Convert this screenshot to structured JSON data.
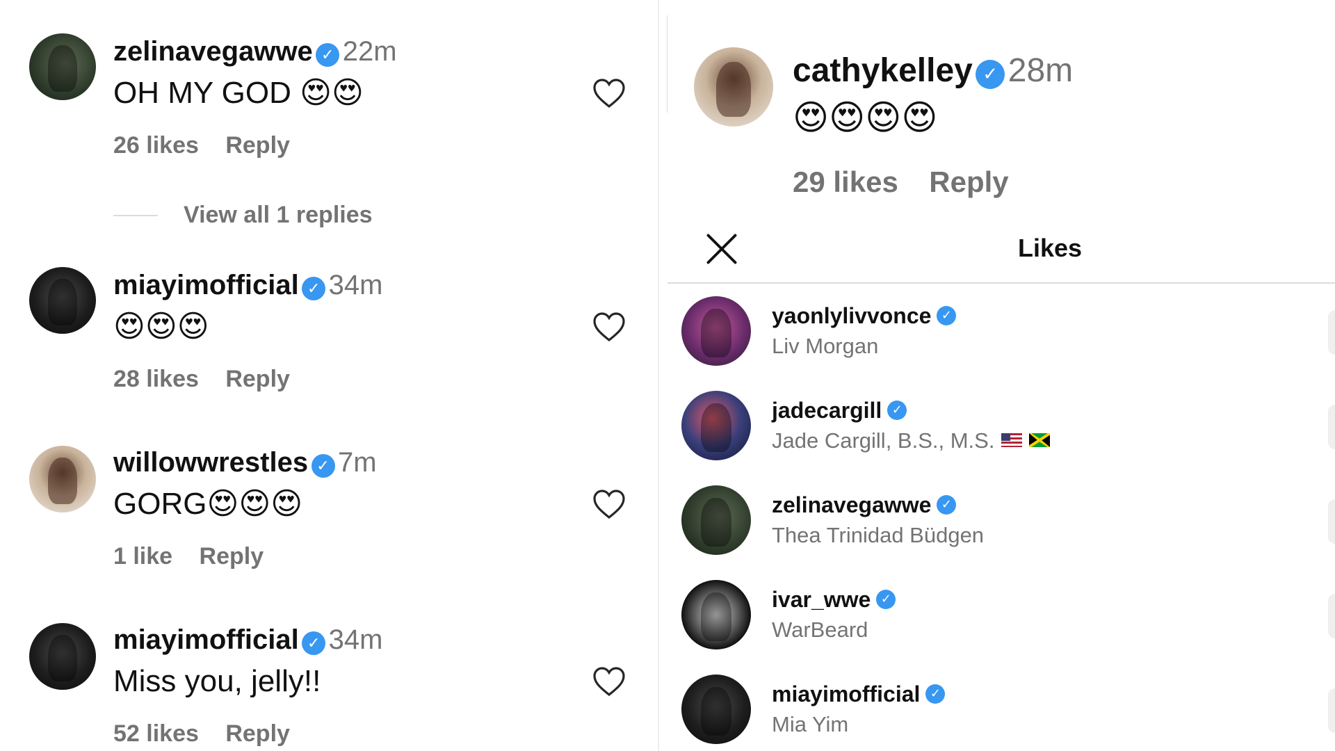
{
  "left_comments": [
    {
      "username": "zelinavegawwe",
      "time": "22m",
      "text": "OH MY GOD ",
      "emojis": "😍😍",
      "likes": "26 likes",
      "reply": "Reply",
      "view_replies": "View all 1 replies"
    },
    {
      "username": "miayimofficial",
      "time": "34m",
      "text": "",
      "emojis": "😍😍😍",
      "likes": "28 likes",
      "reply": "Reply"
    },
    {
      "username": "willowwrestles",
      "time": "7m",
      "text": "GORG",
      "emojis": "😍😍😍",
      "likes": "1 like",
      "reply": "Reply"
    },
    {
      "username": "miayimofficial",
      "time": "34m",
      "text": "Miss you, jelly!!",
      "emojis": "",
      "likes": "52 likes",
      "reply": "Reply"
    }
  ],
  "top_comment": {
    "username": "cathykelley",
    "time": "28m",
    "emojis": "😍😍😍😍",
    "likes": "29 likes",
    "reply": "Reply"
  },
  "likes_panel": {
    "title": "Likes",
    "close_icon": "close-icon",
    "users": [
      {
        "username": "yaonlylivvonce",
        "full_name": "Liv Morgan"
      },
      {
        "username": "jadecargill",
        "full_name": "Jade Cargill, B.S., M.S."
      },
      {
        "username": "zelinavegawwe",
        "full_name": "Thea Trinidad Büdgen"
      },
      {
        "username": "ivar_wwe",
        "full_name": "WarBeard"
      },
      {
        "username": "miayimofficial",
        "full_name": "Mia Yim"
      }
    ]
  },
  "icons": {
    "verified": "verified-badge-icon",
    "heart": "heart-outline-icon"
  },
  "colors": {
    "verified_blue": "#3897f0",
    "secondary_text": "#737373",
    "divider": "#dbdbdb"
  }
}
